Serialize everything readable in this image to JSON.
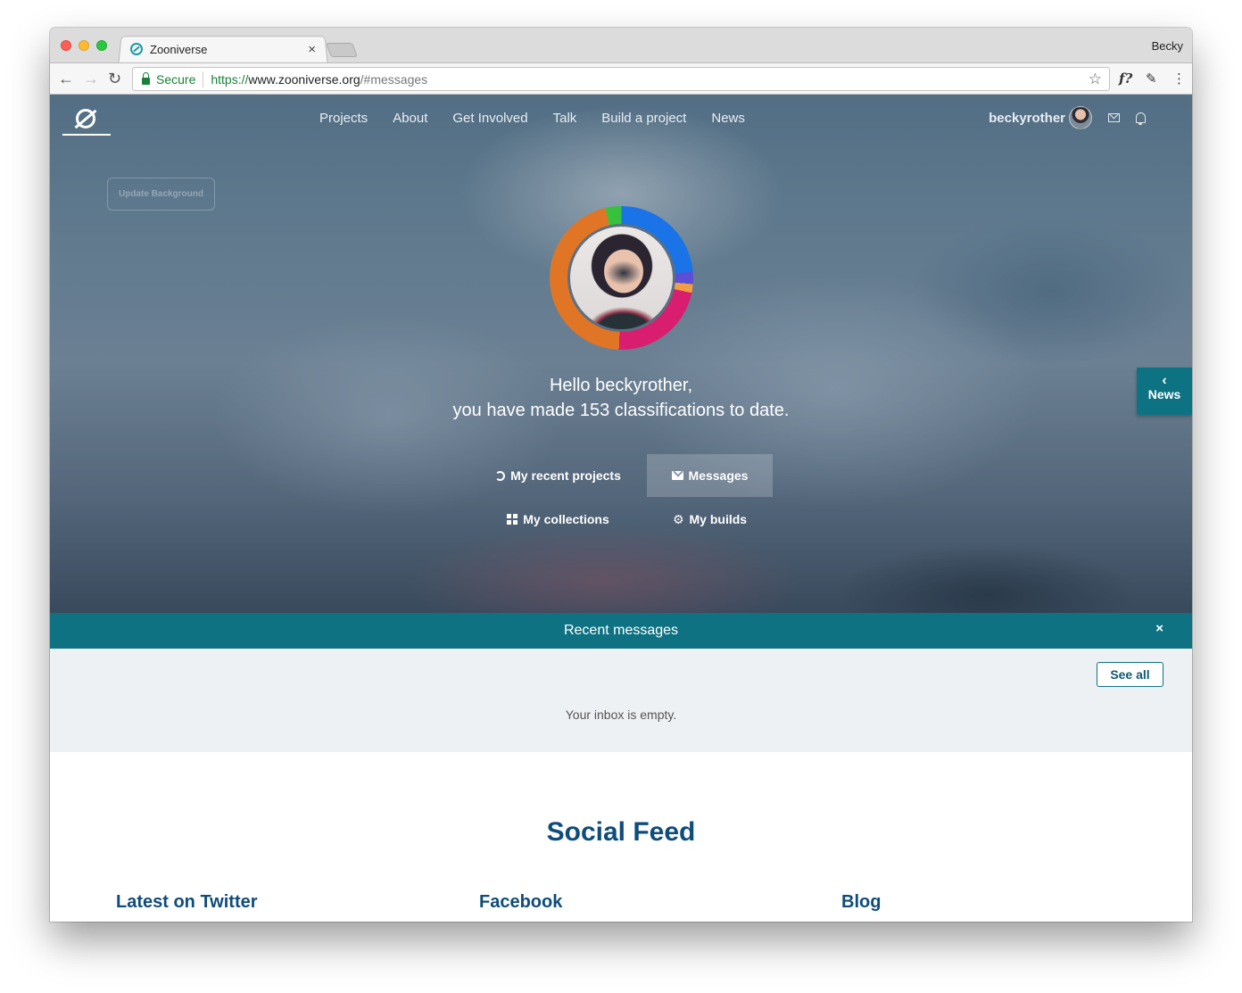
{
  "browser": {
    "tab_title": "Zooniverse",
    "tab_close": "×",
    "profile_name": "Becky",
    "secure_label": "Secure",
    "url_scheme": "https://",
    "url_host": "www.zooniverse.org",
    "url_path": "/#messages",
    "icons": [
      "back-arrow-icon",
      "forward-arrow-icon",
      "reload-icon",
      "star-icon",
      "f-extension-icon",
      "evernote-icon",
      "menu-icon"
    ]
  },
  "nav": {
    "links": [
      "Projects",
      "About",
      "Get Involved",
      "Talk",
      "Build a project",
      "News"
    ],
    "username": "beckyrother"
  },
  "hero": {
    "update_background": "Update Background",
    "greeting_line1": "Hello beckyrother,",
    "greeting_line2": "you have made 153 classifications to date.",
    "links": {
      "recent": "My recent projects",
      "messages": "Messages",
      "collections": "My collections",
      "builds": "My builds"
    },
    "active_link": "messages"
  },
  "news_tab": {
    "label": "News",
    "chevron": "‹"
  },
  "messages": {
    "title": "Recent messages",
    "close": "×",
    "see_all": "See all",
    "empty_text": "Your inbox is empty."
  },
  "social": {
    "title": "Social Feed",
    "twitter": "Latest on Twitter",
    "facebook": "Facebook",
    "blog": "Blog"
  },
  "colors": {
    "teal": "#0e7282",
    "heading_blue": "#0e4c7a",
    "ring_segments": [
      "#1a74e8",
      "#5a4fd6",
      "#f0a040",
      "#d91e6f",
      "#e07526",
      "#36c23c"
    ]
  }
}
